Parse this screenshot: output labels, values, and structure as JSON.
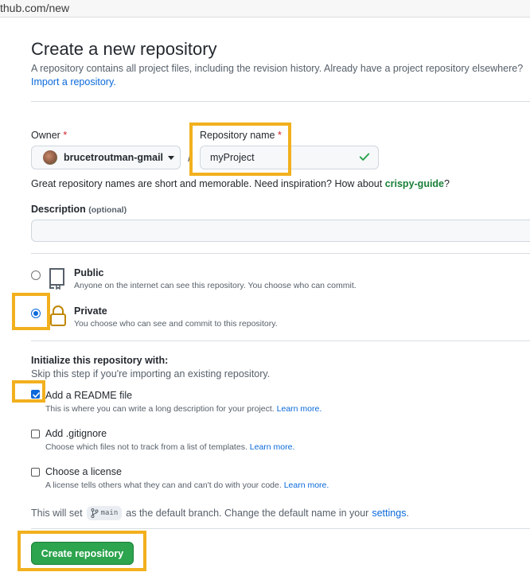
{
  "browser": {
    "url": "thub.com/new"
  },
  "header": {
    "title": "Create a new repository",
    "subtitle": "A repository contains all project files, including the revision history. Already have a project repository elsewhere?",
    "import_link": "Import a repository."
  },
  "owner": {
    "label": "Owner",
    "required_mark": "*",
    "value": "brucetroutman-gmail"
  },
  "separator": "/",
  "repo_name": {
    "label": "Repository name",
    "required_mark": "*",
    "value": "myProject"
  },
  "name_hint": {
    "text": "Great repository names are short and memorable. Need inspiration? How about",
    "suggestion": "crispy-guide",
    "end": "?"
  },
  "description": {
    "label": "Description",
    "optional": "(optional)",
    "value": ""
  },
  "visibility": {
    "selected": "private",
    "public": {
      "title": "Public",
      "desc": "Anyone on the internet can see this repository. You choose who can commit."
    },
    "private": {
      "title": "Private",
      "desc": "You choose who can see and commit to this repository."
    }
  },
  "init": {
    "title": "Initialize this repository with:",
    "subtitle": "Skip this step if you're importing an existing repository.",
    "readme": {
      "checked": true,
      "title": "Add a README file",
      "desc": "This is where you can write a long description for your project.",
      "learn": "Learn more."
    },
    "gitignore": {
      "checked": false,
      "title": "Add .gitignore",
      "desc": "Choose which files not to track from a list of templates.",
      "learn": "Learn more."
    },
    "license": {
      "checked": false,
      "title": "Choose a license",
      "desc": "A license tells others what they can and can't do with your code.",
      "learn": "Learn more."
    }
  },
  "branch": {
    "prefix": "This will set",
    "name": "main",
    "suffix": "as the default branch. Change the default name in your",
    "settings_link": "settings",
    "end": "."
  },
  "submit": {
    "label": "Create repository"
  },
  "colors": {
    "accent": "#0969da",
    "primary_button": "#2da44e",
    "highlight": "#f2b01e",
    "success": "#1a7f37"
  }
}
